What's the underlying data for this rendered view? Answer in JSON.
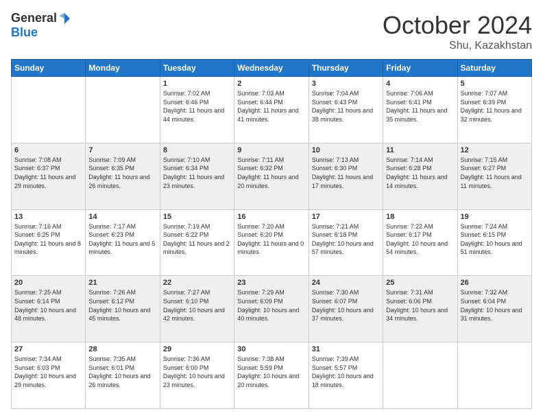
{
  "header": {
    "logo_general": "General",
    "logo_blue": "Blue",
    "month": "October 2024",
    "location": "Shu, Kazakhstan"
  },
  "days_of_week": [
    "Sunday",
    "Monday",
    "Tuesday",
    "Wednesday",
    "Thursday",
    "Friday",
    "Saturday"
  ],
  "weeks": [
    [
      {
        "day": "",
        "info": ""
      },
      {
        "day": "",
        "info": ""
      },
      {
        "day": "1",
        "sunrise": "Sunrise: 7:02 AM",
        "sunset": "Sunset: 6:46 PM",
        "daylight": "Daylight: 11 hours and 44 minutes."
      },
      {
        "day": "2",
        "sunrise": "Sunrise: 7:03 AM",
        "sunset": "Sunset: 6:44 PM",
        "daylight": "Daylight: 11 hours and 41 minutes."
      },
      {
        "day": "3",
        "sunrise": "Sunrise: 7:04 AM",
        "sunset": "Sunset: 6:43 PM",
        "daylight": "Daylight: 11 hours and 38 minutes."
      },
      {
        "day": "4",
        "sunrise": "Sunrise: 7:06 AM",
        "sunset": "Sunset: 6:41 PM",
        "daylight": "Daylight: 11 hours and 35 minutes."
      },
      {
        "day": "5",
        "sunrise": "Sunrise: 7:07 AM",
        "sunset": "Sunset: 6:39 PM",
        "daylight": "Daylight: 11 hours and 32 minutes."
      }
    ],
    [
      {
        "day": "6",
        "sunrise": "Sunrise: 7:08 AM",
        "sunset": "Sunset: 6:37 PM",
        "daylight": "Daylight: 11 hours and 29 minutes."
      },
      {
        "day": "7",
        "sunrise": "Sunrise: 7:09 AM",
        "sunset": "Sunset: 6:35 PM",
        "daylight": "Daylight: 11 hours and 26 minutes."
      },
      {
        "day": "8",
        "sunrise": "Sunrise: 7:10 AM",
        "sunset": "Sunset: 6:34 PM",
        "daylight": "Daylight: 11 hours and 23 minutes."
      },
      {
        "day": "9",
        "sunrise": "Sunrise: 7:11 AM",
        "sunset": "Sunset: 6:32 PM",
        "daylight": "Daylight: 11 hours and 20 minutes."
      },
      {
        "day": "10",
        "sunrise": "Sunrise: 7:13 AM",
        "sunset": "Sunset: 6:30 PM",
        "daylight": "Daylight: 11 hours and 17 minutes."
      },
      {
        "day": "11",
        "sunrise": "Sunrise: 7:14 AM",
        "sunset": "Sunset: 6:28 PM",
        "daylight": "Daylight: 11 hours and 14 minutes."
      },
      {
        "day": "12",
        "sunrise": "Sunrise: 7:15 AM",
        "sunset": "Sunset: 6:27 PM",
        "daylight": "Daylight: 11 hours and 11 minutes."
      }
    ],
    [
      {
        "day": "13",
        "sunrise": "Sunrise: 7:16 AM",
        "sunset": "Sunset: 6:25 PM",
        "daylight": "Daylight: 11 hours and 8 minutes."
      },
      {
        "day": "14",
        "sunrise": "Sunrise: 7:17 AM",
        "sunset": "Sunset: 6:23 PM",
        "daylight": "Daylight: 11 hours and 5 minutes."
      },
      {
        "day": "15",
        "sunrise": "Sunrise: 7:19 AM",
        "sunset": "Sunset: 6:22 PM",
        "daylight": "Daylight: 11 hours and 2 minutes."
      },
      {
        "day": "16",
        "sunrise": "Sunrise: 7:20 AM",
        "sunset": "Sunset: 6:20 PM",
        "daylight": "Daylight: 11 hours and 0 minutes."
      },
      {
        "day": "17",
        "sunrise": "Sunrise: 7:21 AM",
        "sunset": "Sunset: 6:18 PM",
        "daylight": "Daylight: 10 hours and 57 minutes."
      },
      {
        "day": "18",
        "sunrise": "Sunrise: 7:22 AM",
        "sunset": "Sunset: 6:17 PM",
        "daylight": "Daylight: 10 hours and 54 minutes."
      },
      {
        "day": "19",
        "sunrise": "Sunrise: 7:24 AM",
        "sunset": "Sunset: 6:15 PM",
        "daylight": "Daylight: 10 hours and 51 minutes."
      }
    ],
    [
      {
        "day": "20",
        "sunrise": "Sunrise: 7:25 AM",
        "sunset": "Sunset: 6:14 PM",
        "daylight": "Daylight: 10 hours and 48 minutes."
      },
      {
        "day": "21",
        "sunrise": "Sunrise: 7:26 AM",
        "sunset": "Sunset: 6:12 PM",
        "daylight": "Daylight: 10 hours and 45 minutes."
      },
      {
        "day": "22",
        "sunrise": "Sunrise: 7:27 AM",
        "sunset": "Sunset: 6:10 PM",
        "daylight": "Daylight: 10 hours and 42 minutes."
      },
      {
        "day": "23",
        "sunrise": "Sunrise: 7:29 AM",
        "sunset": "Sunset: 6:09 PM",
        "daylight": "Daylight: 10 hours and 40 minutes."
      },
      {
        "day": "24",
        "sunrise": "Sunrise: 7:30 AM",
        "sunset": "Sunset: 6:07 PM",
        "daylight": "Daylight: 10 hours and 37 minutes."
      },
      {
        "day": "25",
        "sunrise": "Sunrise: 7:31 AM",
        "sunset": "Sunset: 6:06 PM",
        "daylight": "Daylight: 10 hours and 34 minutes."
      },
      {
        "day": "26",
        "sunrise": "Sunrise: 7:32 AM",
        "sunset": "Sunset: 6:04 PM",
        "daylight": "Daylight: 10 hours and 31 minutes."
      }
    ],
    [
      {
        "day": "27",
        "sunrise": "Sunrise: 7:34 AM",
        "sunset": "Sunset: 6:03 PM",
        "daylight": "Daylight: 10 hours and 29 minutes."
      },
      {
        "day": "28",
        "sunrise": "Sunrise: 7:35 AM",
        "sunset": "Sunset: 6:01 PM",
        "daylight": "Daylight: 10 hours and 26 minutes."
      },
      {
        "day": "29",
        "sunrise": "Sunrise: 7:36 AM",
        "sunset": "Sunset: 6:00 PM",
        "daylight": "Daylight: 10 hours and 23 minutes."
      },
      {
        "day": "30",
        "sunrise": "Sunrise: 7:38 AM",
        "sunset": "Sunset: 5:59 PM",
        "daylight": "Daylight: 10 hours and 20 minutes."
      },
      {
        "day": "31",
        "sunrise": "Sunrise: 7:39 AM",
        "sunset": "Sunset: 5:57 PM",
        "daylight": "Daylight: 10 hours and 18 minutes."
      },
      {
        "day": "",
        "info": ""
      },
      {
        "day": "",
        "info": ""
      }
    ]
  ]
}
